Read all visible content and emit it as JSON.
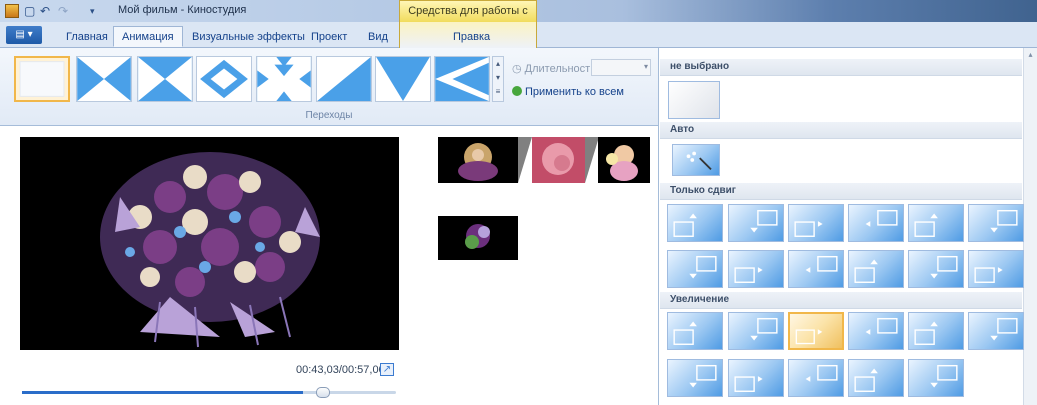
{
  "window": {
    "title": "Мой фильм - Киностудия",
    "context_tab_group": "Средства для работы с видео"
  },
  "ribbon": {
    "file_button": "▤ ▾",
    "tabs": [
      "Главная",
      "Анимация",
      "Визуальные эффекты",
      "Проект",
      "Вид"
    ],
    "context_tab": "Правка",
    "duration_label": "Длительность:",
    "duration_value": "",
    "apply_all": "Применить ко всем",
    "group_label": "Переходы"
  },
  "player": {
    "time": "00:43,03/00:57,00",
    "progress_fraction": 0.75
  },
  "pan_zoom_panel": {
    "sections": [
      "не выбрано",
      "Авто",
      "Только сдвиг",
      "Увеличение"
    ]
  },
  "colors": {
    "accent": "#2a6dc9",
    "selection": "#f1b74a",
    "context_tab": "#f1dc5d"
  }
}
